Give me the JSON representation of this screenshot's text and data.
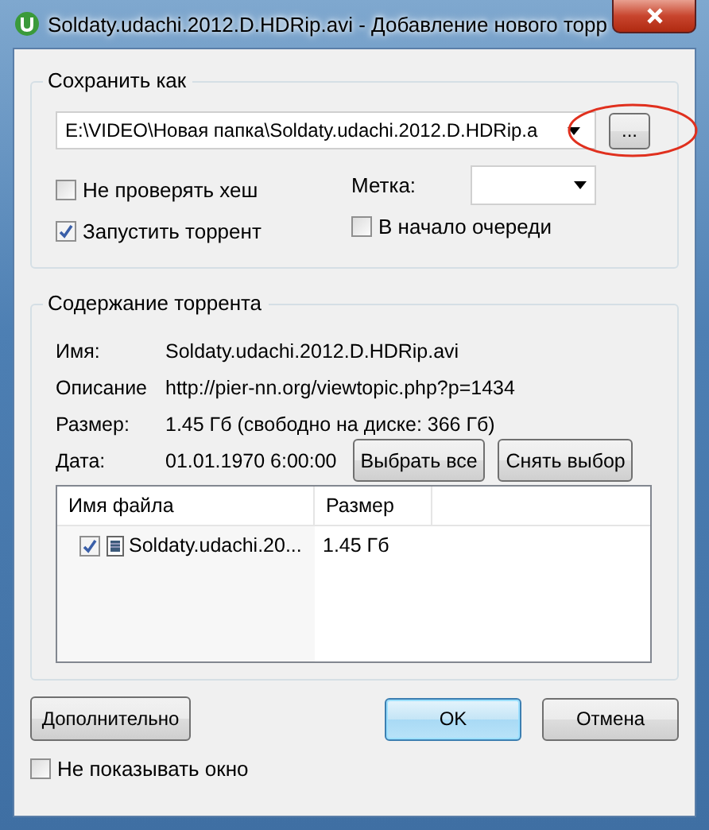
{
  "window": {
    "title": "Soldaty.udachi.2012.D.HDRip.avi - Добавление нового торр"
  },
  "save_group": {
    "legend": "Сохранить как",
    "path": "E:\\VIDEO\\Новая папка\\Soldaty.udachi.2012.D.HDRip.a",
    "browse": "...",
    "options": [
      {
        "label": "Не проверять хеш",
        "checked": false
      },
      {
        "label": "Запустить торрент",
        "checked": true
      },
      {
        "label": "В начало очереди",
        "checked": false
      }
    ],
    "tag_label": "Метка:"
  },
  "content_group": {
    "legend": "Содержание торрента",
    "info": [
      {
        "label": "Имя:",
        "value": "Soldaty.udachi.2012.D.HDRip.avi"
      },
      {
        "label": "Описание",
        "value": "http://pier-nn.org/viewtopic.php?p=1434"
      },
      {
        "label": "Размер:",
        "value": "1.45 Гб (свободно на диске: 366 Гб)"
      },
      {
        "label": "Дата:",
        "value": "01.01.1970 6:00:00"
      }
    ],
    "buttons": [
      "Выбрать все",
      "Снять выбор"
    ],
    "columns": [
      "Имя файла",
      "Размер"
    ],
    "files": [
      {
        "name": "Soldaty.udachi.20...",
        "size": "1.45 Гб",
        "checked": true
      }
    ]
  },
  "buttons": {
    "advanced": "Дополнительно",
    "ok": "OK",
    "cancel": "Отмена"
  },
  "hide_window": {
    "label": "Не показывать окно",
    "checked": false
  }
}
